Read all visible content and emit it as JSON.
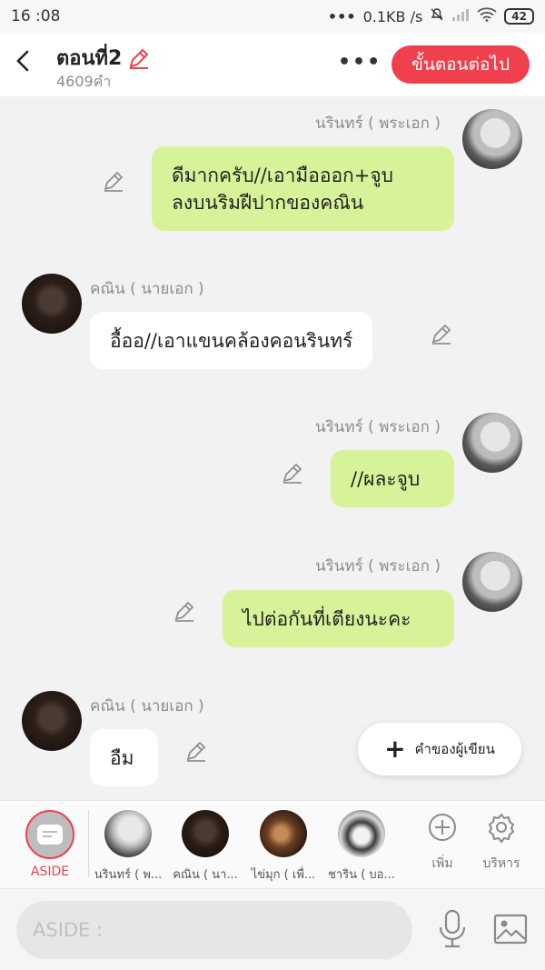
{
  "status_bar": {
    "time": "16 :08",
    "network_speed": "0.1KB /s",
    "battery": "42"
  },
  "header": {
    "title": "ตอนที่2",
    "word_count": "4609คำ",
    "more_label": "•••",
    "next_step_label": "ขั้นตอนต่อไป",
    "accent_color": "#f0404e"
  },
  "messages": [
    {
      "side": "right",
      "sender": "นรินทร์ ( พระเอก )",
      "text_line1": "ดีมากครับ//เอามือออก+จูบ",
      "text_line2": "ลงบนริมฝีปากของคณิน"
    },
    {
      "side": "left",
      "sender": "คณิน ( นายเอก )",
      "text": "อื้ออ//เอาแขนคล้องคอนรินทร์"
    },
    {
      "side": "right",
      "sender": "นรินทร์ ( พระเอก )",
      "text": "//ผละจูบ"
    },
    {
      "side": "right",
      "sender": "นรินทร์ ( พระเอก )",
      "text": "ไปต่อกันที่เตียงนะคะ"
    },
    {
      "side": "left",
      "sender": "คณิน ( นายเอก )",
      "text": "อืม"
    }
  ],
  "add_note": {
    "label": "คำของผู้เขียน"
  },
  "char_bar": {
    "aside_label": "ASIDE",
    "characters": [
      {
        "label": "นรินทร์ ( พ..."
      },
      {
        "label": "คณิน ( นา..."
      },
      {
        "label": "ไข่มุก ( เพื่..."
      },
      {
        "label": "ชาริน ( บอ..."
      }
    ],
    "add_label": "เพิ่ม",
    "manage_label": "บริหาร"
  },
  "input_bar": {
    "placeholder": "ASIDE :",
    "value": ""
  },
  "icons": {
    "edit": "pencil-icon",
    "mic": "microphone-icon",
    "image": "image-icon",
    "add": "plus-circle-icon",
    "manage": "gear-icon"
  },
  "colors": {
    "bubble_right": "#d6f39a",
    "bubble_left": "#ffffff",
    "background": "#f2f2f2"
  }
}
